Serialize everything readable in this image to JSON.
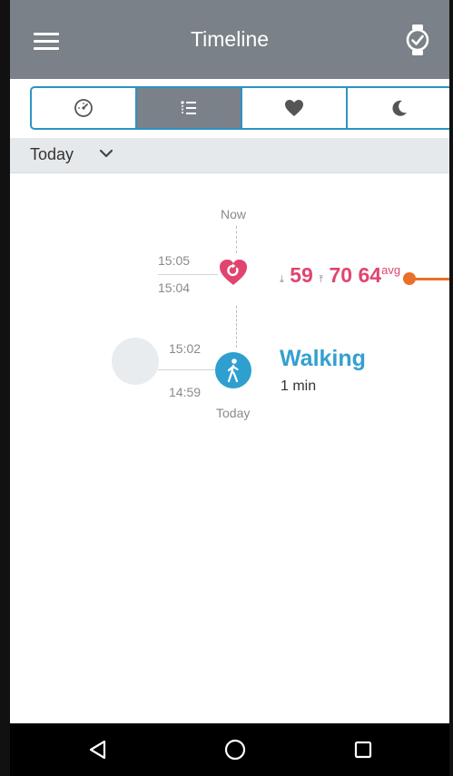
{
  "app_bar": {
    "title": "Timeline",
    "menu_icon": "hamburger-menu-icon",
    "watch_icon": "watch-sync-icon"
  },
  "tabs": [
    {
      "icon": "dashboard-gauge-icon",
      "active": false
    },
    {
      "icon": "timeline-list-icon",
      "active": true
    },
    {
      "icon": "heart-icon",
      "active": false
    },
    {
      "icon": "moon-sleep-icon",
      "active": false
    }
  ],
  "date_filter": {
    "value": "Today",
    "icon": "chevron-down-icon"
  },
  "timeline": {
    "now_label": "Now",
    "today_label": "Today",
    "heart_rate_entry": {
      "start_time": "15:05",
      "end_time": "15:04",
      "icon": "heart-rate-icon",
      "min_value": "59",
      "max_value": "70",
      "avg_value": "64",
      "avg_label": "avg"
    },
    "activity_entry": {
      "start_time": "15:02",
      "end_time": "14:59",
      "icon": "walking-icon",
      "name": "Walking",
      "duration": "1 min"
    }
  },
  "nav_bar": {
    "back_icon": "back-triangle-icon",
    "home_icon": "home-circle-icon",
    "recents_icon": "recents-square-icon"
  },
  "colors": {
    "app_bar": "#7a8188",
    "accent_blue": "#2e93c4",
    "heart_pink": "#e0456f",
    "pointer_orange": "#e9702a"
  }
}
